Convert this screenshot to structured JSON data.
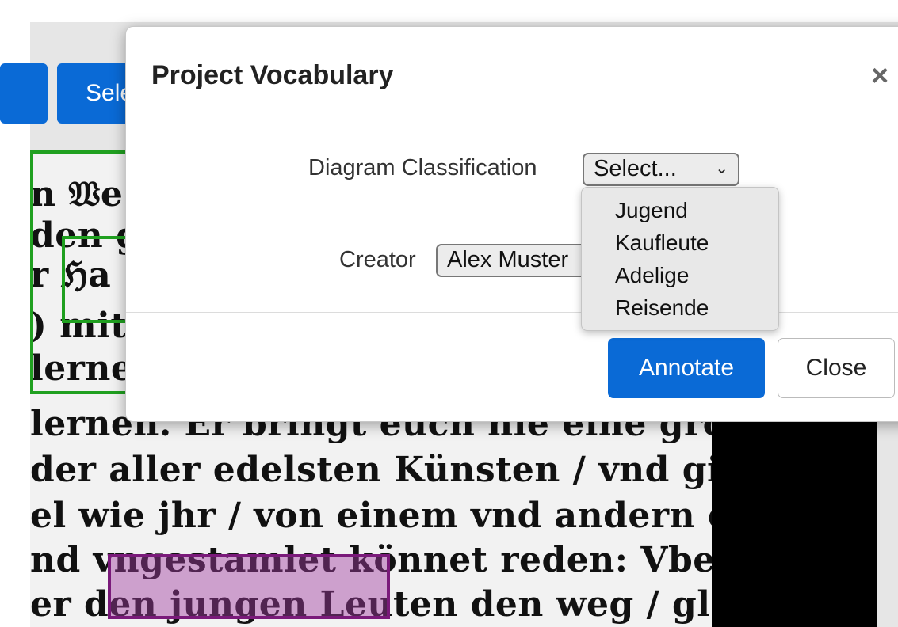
{
  "background": {
    "toolbar_button_label": "Sele",
    "scan_lines": [
      "n 𝔚e",
      "den gu",
      "r  ℌa",
      ") mit",
      "lerne",
      "lernen.  Er bringt euch hie eine grosse",
      "der aller edelsten Künsten / vnd gibet",
      "el wie jhr / von einem vnd andern eis",
      "nd vngestamlet  könnet reden: Vber",
      "er den jungen Leuten  den weg / gleich"
    ]
  },
  "modal": {
    "title": "Project Vocabulary",
    "close_icon": "×",
    "diagram_classification": {
      "label": "Diagram Classification",
      "selected": "Select...",
      "options": [
        "Jugend",
        "Kaufleute",
        "Adelige",
        "Reisende"
      ]
    },
    "creator": {
      "label": "Creator",
      "selected": "Alex Muster"
    },
    "annotate_label": "Annotate",
    "close_label": "Close"
  },
  "colors": {
    "primary": "#0a6ad6",
    "annotation_green": "#20a020",
    "annotation_purple": "#7a1a7a"
  }
}
